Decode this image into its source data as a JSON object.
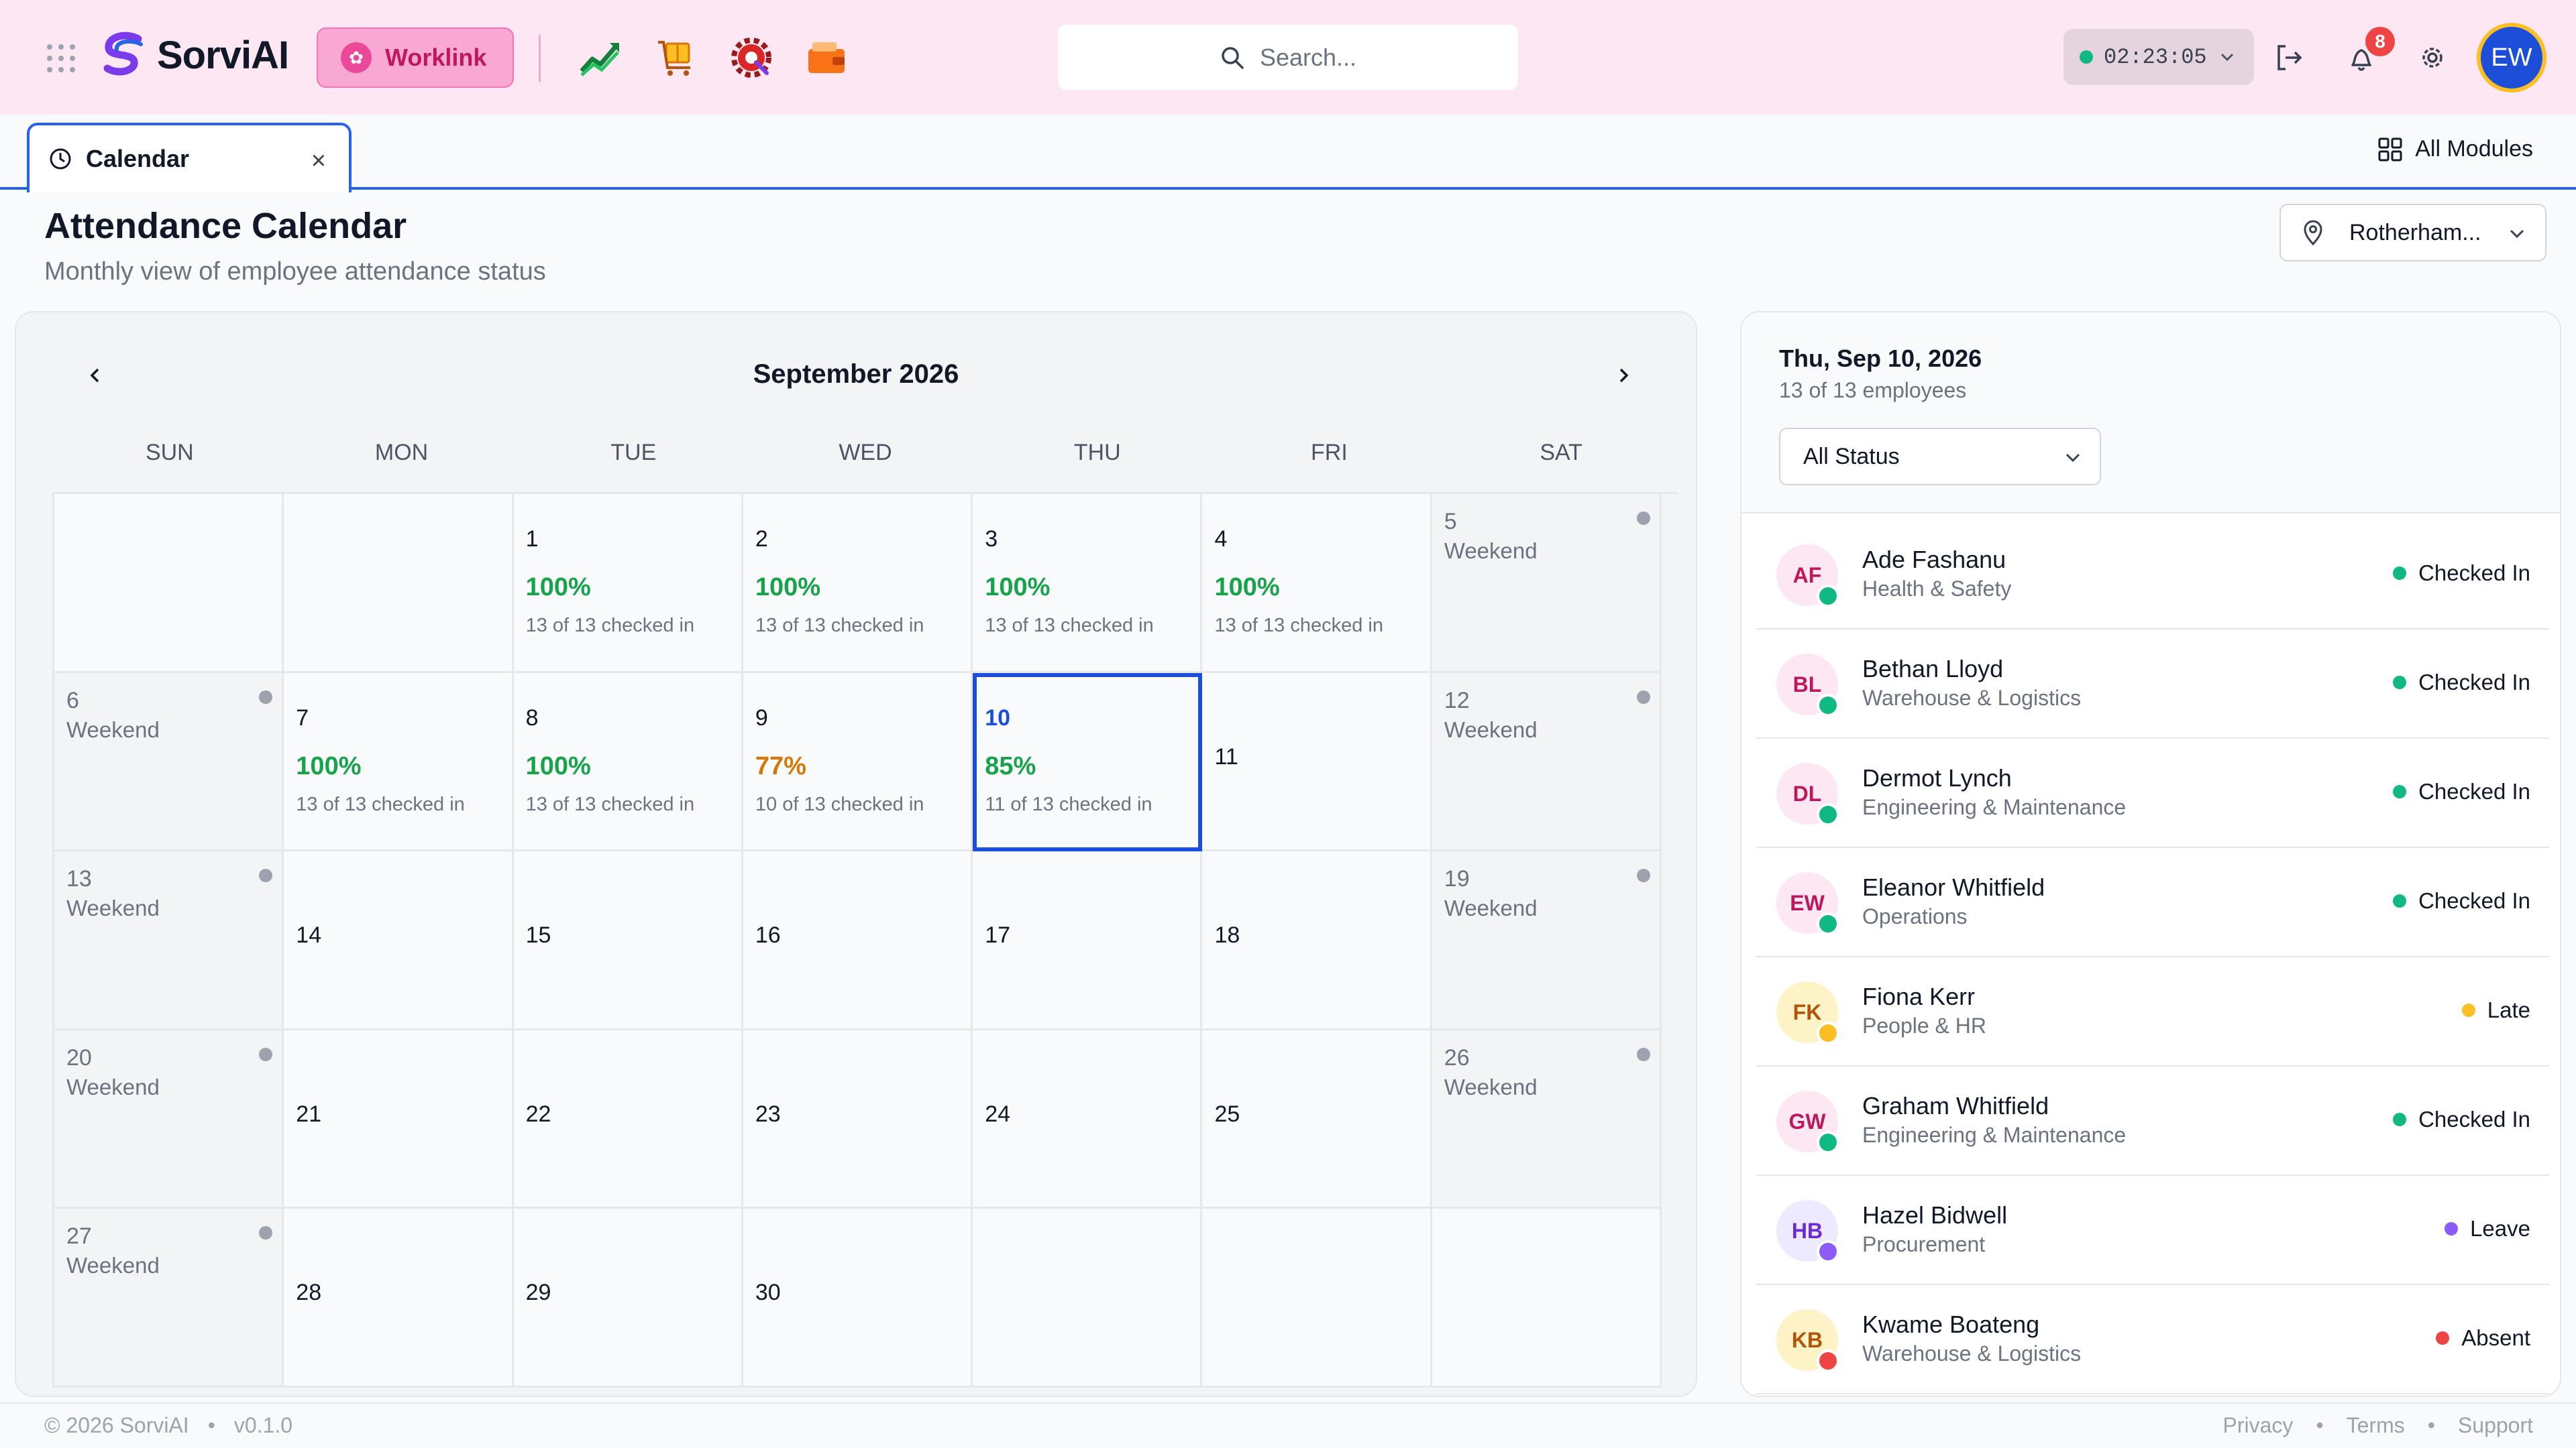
{
  "app": {
    "brand": "SorviAI",
    "module_button": "Worklink"
  },
  "search": {
    "placeholder": "Search..."
  },
  "timer": "02:23:05",
  "notifications": {
    "count": "8"
  },
  "user": {
    "initials": "EW"
  },
  "tabs": [
    {
      "label": "Calendar",
      "close": "×"
    }
  ],
  "all_modules": "All Modules",
  "page": {
    "title": "Attendance Calendar",
    "subtitle": "Monthly view of employee attendance status"
  },
  "location": {
    "value": "Rotherham..."
  },
  "calendar": {
    "month": "September 2026",
    "weekdays": [
      "SUN",
      "MON",
      "TUE",
      "WED",
      "THU",
      "FRI",
      "SAT"
    ],
    "weekend_label": "Weekend",
    "colors": {
      "green": "#16a34a",
      "orange": "#d97706",
      "selected": "#1d4ed8"
    },
    "cells": [
      {
        "type": "empty"
      },
      {
        "type": "empty"
      },
      {
        "type": "stat",
        "day": "1",
        "pct": "100%",
        "sub": "13 of 13 checked in",
        "tone": "green"
      },
      {
        "type": "stat",
        "day": "2",
        "pct": "100%",
        "sub": "13 of 13 checked in",
        "tone": "green"
      },
      {
        "type": "stat",
        "day": "3",
        "pct": "100%",
        "sub": "13 of 13 checked in",
        "tone": "green"
      },
      {
        "type": "stat",
        "day": "4",
        "pct": "100%",
        "sub": "13 of 13 checked in",
        "tone": "green"
      },
      {
        "type": "weekend",
        "day": "5"
      },
      {
        "type": "weekend",
        "day": "6"
      },
      {
        "type": "stat",
        "day": "7",
        "pct": "100%",
        "sub": "13 of 13 checked in",
        "tone": "green"
      },
      {
        "type": "stat",
        "day": "8",
        "pct": "100%",
        "sub": "13 of 13 checked in",
        "tone": "green"
      },
      {
        "type": "stat",
        "day": "9",
        "pct": "77%",
        "sub": "10 of 13 checked in",
        "tone": "orange"
      },
      {
        "type": "stat",
        "day": "10",
        "pct": "85%",
        "sub": "11 of 13 checked in",
        "tone": "green",
        "selected": true
      },
      {
        "type": "plain",
        "day": "11"
      },
      {
        "type": "weekend",
        "day": "12"
      },
      {
        "type": "weekend",
        "day": "13"
      },
      {
        "type": "plain",
        "day": "14"
      },
      {
        "type": "plain",
        "day": "15"
      },
      {
        "type": "plain",
        "day": "16"
      },
      {
        "type": "plain",
        "day": "17"
      },
      {
        "type": "plain",
        "day": "18"
      },
      {
        "type": "weekend",
        "day": "19"
      },
      {
        "type": "weekend",
        "day": "20"
      },
      {
        "type": "plain",
        "day": "21"
      },
      {
        "type": "plain",
        "day": "22"
      },
      {
        "type": "plain",
        "day": "23"
      },
      {
        "type": "plain",
        "day": "24"
      },
      {
        "type": "plain",
        "day": "25"
      },
      {
        "type": "weekend",
        "day": "26"
      },
      {
        "type": "weekend",
        "day": "27"
      },
      {
        "type": "plain",
        "day": "28"
      },
      {
        "type": "plain",
        "day": "29"
      },
      {
        "type": "plain",
        "day": "30"
      },
      {
        "type": "empty"
      },
      {
        "type": "empty"
      },
      {
        "type": "empty"
      }
    ]
  },
  "side": {
    "date": "Thu, Sep 10, 2026",
    "count": "13 of 13 employees",
    "status_filter": "All Status",
    "employees": [
      {
        "initials": "AF",
        "name": "Ade Fashanu",
        "dept": "Health & Safety",
        "status": "Checked In",
        "status_color": "#10b981",
        "av_bg": "#fce7f3",
        "av_fg": "#be185d"
      },
      {
        "initials": "BL",
        "name": "Bethan Lloyd",
        "dept": "Warehouse & Logistics",
        "status": "Checked In",
        "status_color": "#10b981",
        "av_bg": "#fce7f3",
        "av_fg": "#be185d"
      },
      {
        "initials": "DL",
        "name": "Dermot Lynch",
        "dept": "Engineering & Maintenance",
        "status": "Checked In",
        "status_color": "#10b981",
        "av_bg": "#fce7f3",
        "av_fg": "#be185d"
      },
      {
        "initials": "EW",
        "name": "Eleanor Whitfield",
        "dept": "Operations",
        "status": "Checked In",
        "status_color": "#10b981",
        "av_bg": "#fce7f3",
        "av_fg": "#be185d"
      },
      {
        "initials": "FK",
        "name": "Fiona Kerr",
        "dept": "People & HR",
        "status": "Late",
        "status_color": "#fbbf24",
        "av_bg": "#fef3c7",
        "av_fg": "#b45309"
      },
      {
        "initials": "GW",
        "name": "Graham Whitfield",
        "dept": "Engineering & Maintenance",
        "status": "Checked In",
        "status_color": "#10b981",
        "av_bg": "#fce7f3",
        "av_fg": "#be185d"
      },
      {
        "initials": "HB",
        "name": "Hazel Bidwell",
        "dept": "Procurement",
        "status": "Leave",
        "status_color": "#8b5cf6",
        "av_bg": "#ede9fe",
        "av_fg": "#6d28d9"
      },
      {
        "initials": "KB",
        "name": "Kwame Boateng",
        "dept": "Warehouse & Logistics",
        "status": "Absent",
        "status_color": "#ef4444",
        "av_bg": "#fef3c7",
        "av_fg": "#b45309"
      }
    ]
  },
  "footer": {
    "copyright": "© 2026 SorviAI",
    "version": "v0.1.0",
    "links": [
      "Privacy",
      "Terms",
      "Support"
    ],
    "separator": "•"
  }
}
